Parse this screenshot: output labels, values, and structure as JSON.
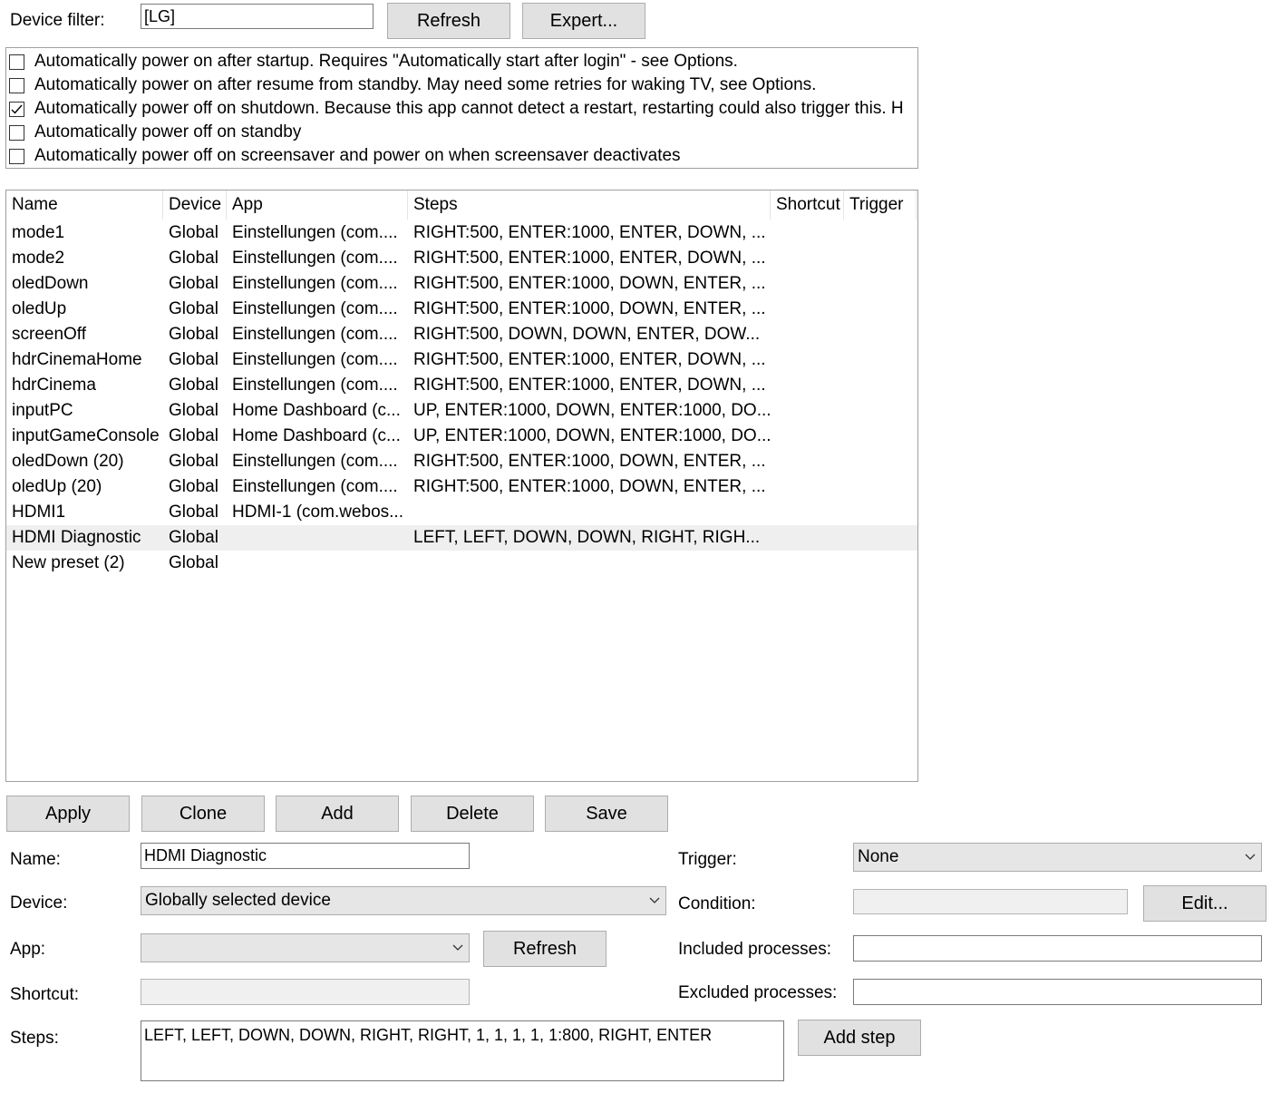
{
  "filter": {
    "label": "Device filter:",
    "value": "[LG]",
    "refresh_label": "Refresh",
    "expert_label": "Expert..."
  },
  "options": [
    {
      "label": "Automatically power on after startup. Requires \"Automatically start after login\" - see Options.",
      "checked": false
    },
    {
      "label": "Automatically power on after resume from standby. May need some retries for waking TV, see Options.",
      "checked": false
    },
    {
      "label": "Automatically power off on shutdown. Because this app cannot detect a restart, restarting could also trigger this. H",
      "checked": true
    },
    {
      "label": "Automatically power off on standby",
      "checked": false
    },
    {
      "label": "Automatically power off on screensaver and power on when screensaver deactivates",
      "checked": false
    }
  ],
  "table": {
    "columns": [
      "Name",
      "Device",
      "App",
      "Steps",
      "Shortcut",
      "Trigger"
    ],
    "rows": [
      [
        "mode1",
        "Global",
        "Einstellungen (com....",
        "RIGHT:500, ENTER:1000, ENTER, DOWN, ...",
        "",
        ""
      ],
      [
        "mode2",
        "Global",
        "Einstellungen (com....",
        "RIGHT:500, ENTER:1000, ENTER, DOWN, ...",
        "",
        ""
      ],
      [
        "oledDown",
        "Global",
        "Einstellungen (com....",
        "RIGHT:500, ENTER:1000, DOWN, ENTER, ...",
        "",
        ""
      ],
      [
        "oledUp",
        "Global",
        "Einstellungen (com....",
        "RIGHT:500, ENTER:1000, DOWN, ENTER, ...",
        "",
        ""
      ],
      [
        "screenOff",
        "Global",
        "Einstellungen (com....",
        "RIGHT:500, DOWN, DOWN, ENTER, DOW...",
        "",
        ""
      ],
      [
        "hdrCinemaHome",
        "Global",
        "Einstellungen (com....",
        "RIGHT:500, ENTER:1000, ENTER, DOWN, ...",
        "",
        ""
      ],
      [
        "hdrCinema",
        "Global",
        "Einstellungen (com....",
        "RIGHT:500, ENTER:1000, ENTER, DOWN, ...",
        "",
        ""
      ],
      [
        "inputPC",
        "Global",
        "Home Dashboard (c...",
        "UP, ENTER:1000, DOWN, ENTER:1000, DO...",
        "",
        ""
      ],
      [
        "inputGameConsole",
        "Global",
        "Home Dashboard (c...",
        "UP, ENTER:1000, DOWN, ENTER:1000, DO...",
        "",
        ""
      ],
      [
        "oledDown (20)",
        "Global",
        "Einstellungen (com....",
        "RIGHT:500, ENTER:1000, DOWN, ENTER, ...",
        "",
        ""
      ],
      [
        "oledUp (20)",
        "Global",
        "Einstellungen (com....",
        "RIGHT:500, ENTER:1000, DOWN, ENTER, ...",
        "",
        ""
      ],
      [
        "HDMI1",
        "Global",
        "HDMI-1 (com.webos...",
        "",
        "",
        ""
      ],
      [
        "HDMI Diagnostic",
        "Global",
        "",
        "LEFT, LEFT, DOWN, DOWN, RIGHT, RIGH...",
        "",
        ""
      ],
      [
        "New preset (2)",
        "Global",
        "",
        "",
        "",
        ""
      ]
    ],
    "selected_index": 12
  },
  "actions": {
    "apply": "Apply",
    "clone": "Clone",
    "add": "Add",
    "delete": "Delete",
    "save": "Save"
  },
  "editor": {
    "name_label": "Name:",
    "name_value": "HDMI Diagnostic",
    "device_label": "Device:",
    "device_value": "Globally selected device",
    "app_label": "App:",
    "app_value": "",
    "app_refresh": "Refresh",
    "shortcut_label": "Shortcut:",
    "shortcut_value": "",
    "steps_label": "Steps:",
    "steps_value": "LEFT, LEFT, DOWN, DOWN, RIGHT, RIGHT, 1, 1, 1, 1, 1:800, RIGHT, ENTER",
    "add_step": "Add step",
    "trigger_label": "Trigger:",
    "trigger_value": "None",
    "condition_label": "Condition:",
    "condition_value": "",
    "condition_edit": "Edit...",
    "included_label": "Included processes:",
    "included_value": "",
    "excluded_label": "Excluded processes:",
    "excluded_value": ""
  }
}
